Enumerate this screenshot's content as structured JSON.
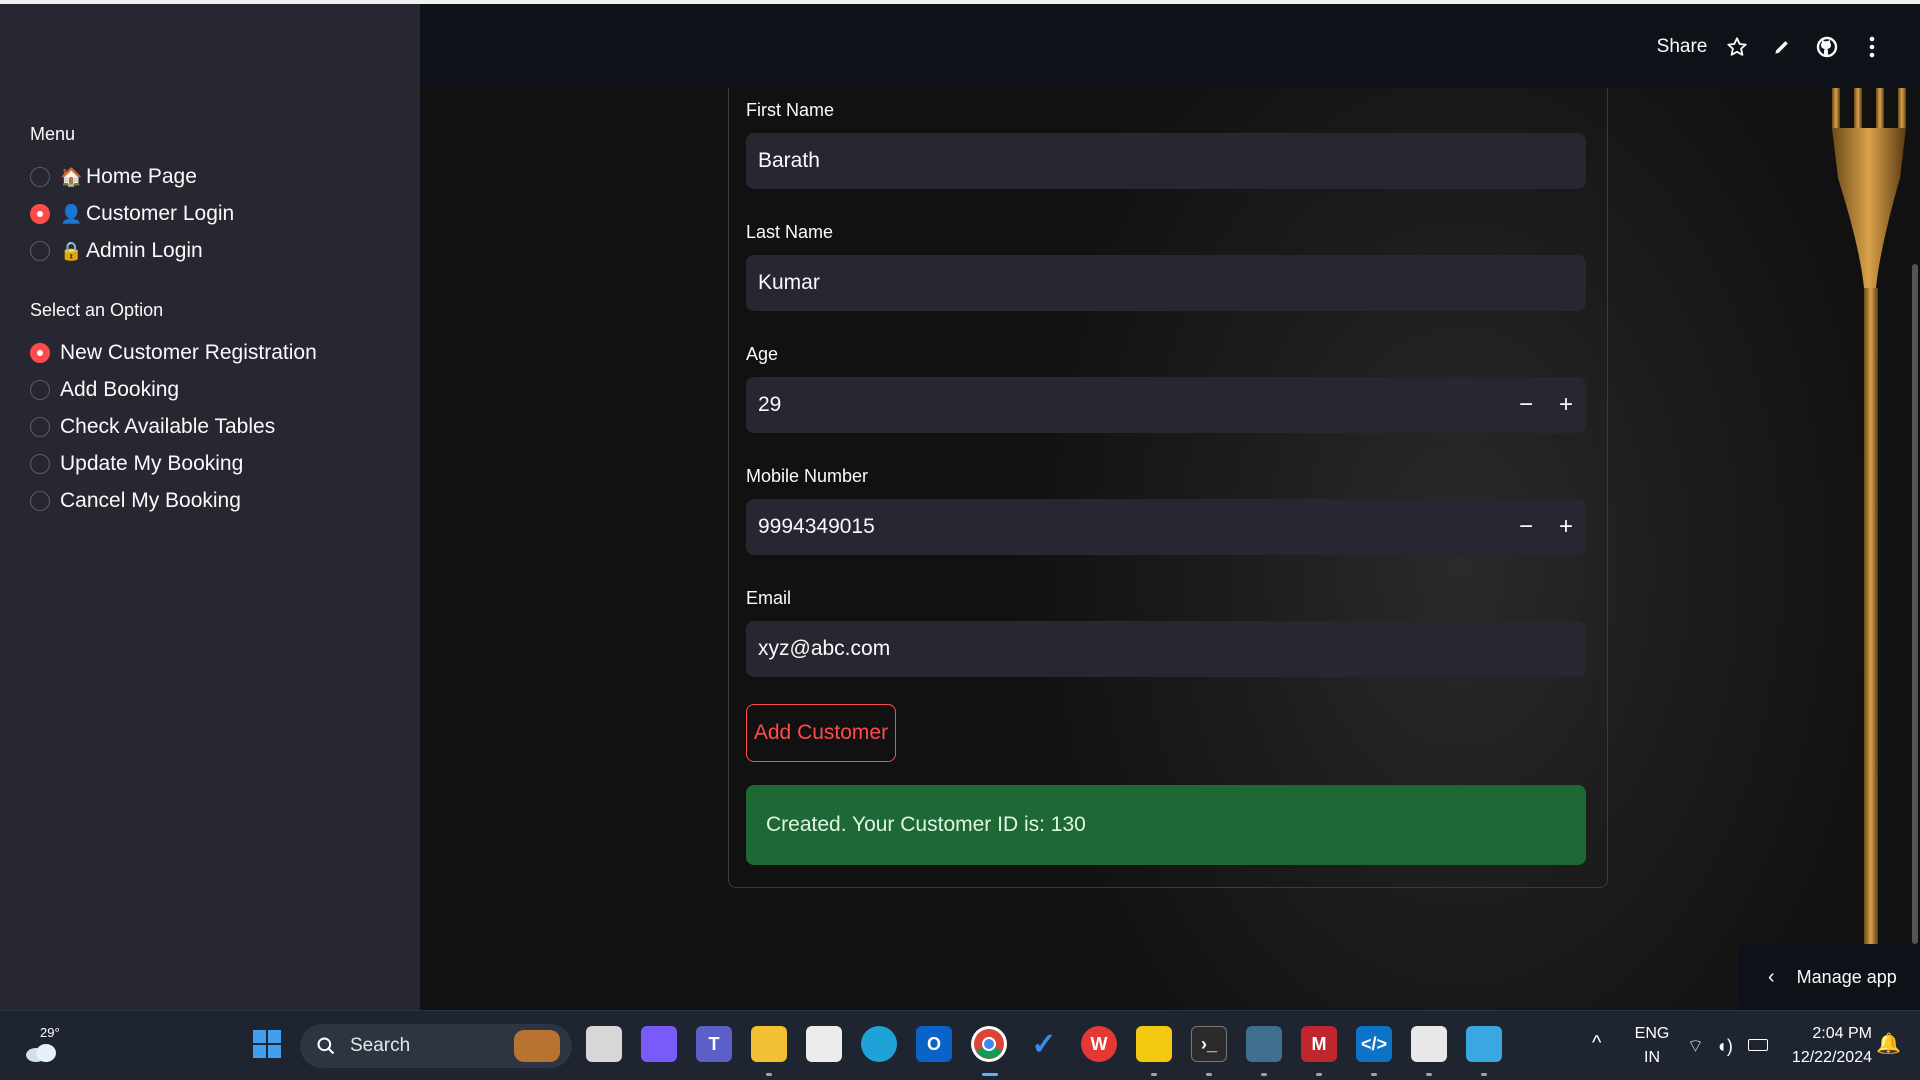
{
  "header": {
    "share_label": "Share",
    "icons": [
      "star-icon",
      "pencil-icon",
      "github-icon",
      "more-vertical-icon"
    ]
  },
  "sidebar": {
    "menu_label": "Menu",
    "menu_items": [
      {
        "emoji": "🏠",
        "label": "Home Page",
        "selected": false
      },
      {
        "emoji": "👤",
        "label": "Customer Login",
        "selected": true
      },
      {
        "emoji": "🔒",
        "label": "Admin Login",
        "selected": false
      }
    ],
    "option_label": "Select an Option",
    "options": [
      {
        "label": "New Customer Registration",
        "selected": true
      },
      {
        "label": "Add Booking",
        "selected": false
      },
      {
        "label": "Check Available Tables",
        "selected": false
      },
      {
        "label": "Update My Booking",
        "selected": false
      },
      {
        "label": "Cancel My Booking",
        "selected": false
      }
    ]
  },
  "form": {
    "first_name": {
      "label": "First Name",
      "value": "Barath"
    },
    "last_name": {
      "label": "Last Name",
      "value": "Kumar"
    },
    "age": {
      "label": "Age",
      "value": "29"
    },
    "mobile": {
      "label": "Mobile Number",
      "value": "9994349015"
    },
    "email": {
      "label": "Email",
      "value": "xyz@abc.com"
    },
    "stepper_minus": "−",
    "stepper_plus": "+",
    "submit_label": "Add Customer",
    "success_message": "Created. Your Customer ID is: 130"
  },
  "manage_app": {
    "label": "Manage app"
  },
  "taskbar": {
    "weather_temp": "29°",
    "search_placeholder": "Search",
    "language": "ENG",
    "region": "IN",
    "time": "2:04 PM",
    "date": "12/22/2024"
  },
  "colors": {
    "accent": "#ff4b4b",
    "sidebar_bg": "#262730",
    "header_bg": "#0e1117",
    "input_bg": "#262730",
    "success_bg": "#1d4a2a"
  }
}
